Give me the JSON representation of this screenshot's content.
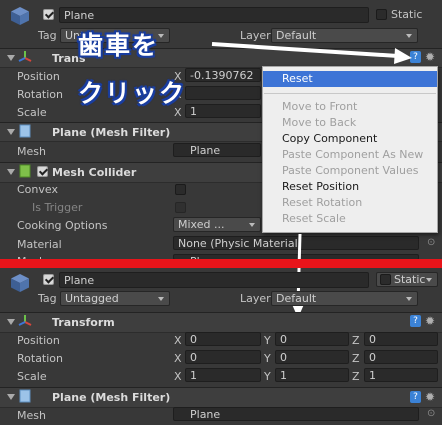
{
  "top": {
    "object_name": "Plane",
    "static_label": "Static",
    "tag_label": "Tag",
    "tag_value": "Untag",
    "layer_label": "Layer",
    "layer_value": "Default",
    "transform_title": "Trans",
    "position_label": "Position",
    "rotation_label": "Rotation",
    "scale_label": "Scale",
    "pos_x": "-0.1390762",
    "scale_x": "1",
    "x_axis": "X",
    "mesh_filter_title": "Plane (Mesh Filter)",
    "mesh_label": "Mesh",
    "mesh_value": "Plane",
    "collider_title": "Mesh Collider",
    "convex_label": "Convex",
    "is_trigger_label": "Is Trigger",
    "cooking_label": "Cooking Options",
    "cooking_value": "Mixed ...",
    "material_label": "Material",
    "material_value": "None (Physic Material)",
    "mesh2_label": "Mesh",
    "mesh2_value": "Plane"
  },
  "context_menu": {
    "items": [
      {
        "label": "Reset",
        "state": "selected"
      },
      {
        "label": "Move to Front",
        "state": "disabled"
      },
      {
        "label": "Move to Back",
        "state": "disabled"
      },
      {
        "label": "Copy Component",
        "state": "enabled"
      },
      {
        "label": "Paste Component As New",
        "state": "disabled"
      },
      {
        "label": "Paste Component Values",
        "state": "disabled"
      },
      {
        "label": "Reset Position",
        "state": "enabled"
      },
      {
        "label": "Reset Rotation",
        "state": "disabled"
      },
      {
        "label": "Reset Scale",
        "state": "disabled"
      }
    ]
  },
  "annotation": {
    "line1": "歯車を",
    "line2": "クリック"
  },
  "bottom": {
    "object_name": "Plane",
    "static_label": "Static",
    "tag_label": "Tag",
    "tag_value": "Untagged",
    "layer_label": "Layer",
    "layer_value": "Default",
    "transform_title": "Transform",
    "position_label": "Position",
    "rotation_label": "Rotation",
    "scale_label": "Scale",
    "axis_x": "X",
    "axis_y": "Y",
    "axis_z": "Z",
    "pos": [
      "0",
      "0",
      "0"
    ],
    "rot": [
      "0",
      "0",
      "0"
    ],
    "scale": [
      "1",
      "1",
      "1"
    ],
    "mesh_filter_title": "Plane (Mesh Filter)",
    "mesh_label": "Mesh",
    "mesh_value": "Plane"
  },
  "colors": {
    "menu_selected": "#3d74d6",
    "divider_red": "#e8141a",
    "arrow": "#ffffff",
    "annotation_outline": "#1a3ea0"
  },
  "icons": [
    "gameobject-cube-icon",
    "transform-axis-icon",
    "mesh-filter-icon",
    "mesh-collider-icon",
    "help-book-icon",
    "gear-icon",
    "target-circle-icon"
  ]
}
